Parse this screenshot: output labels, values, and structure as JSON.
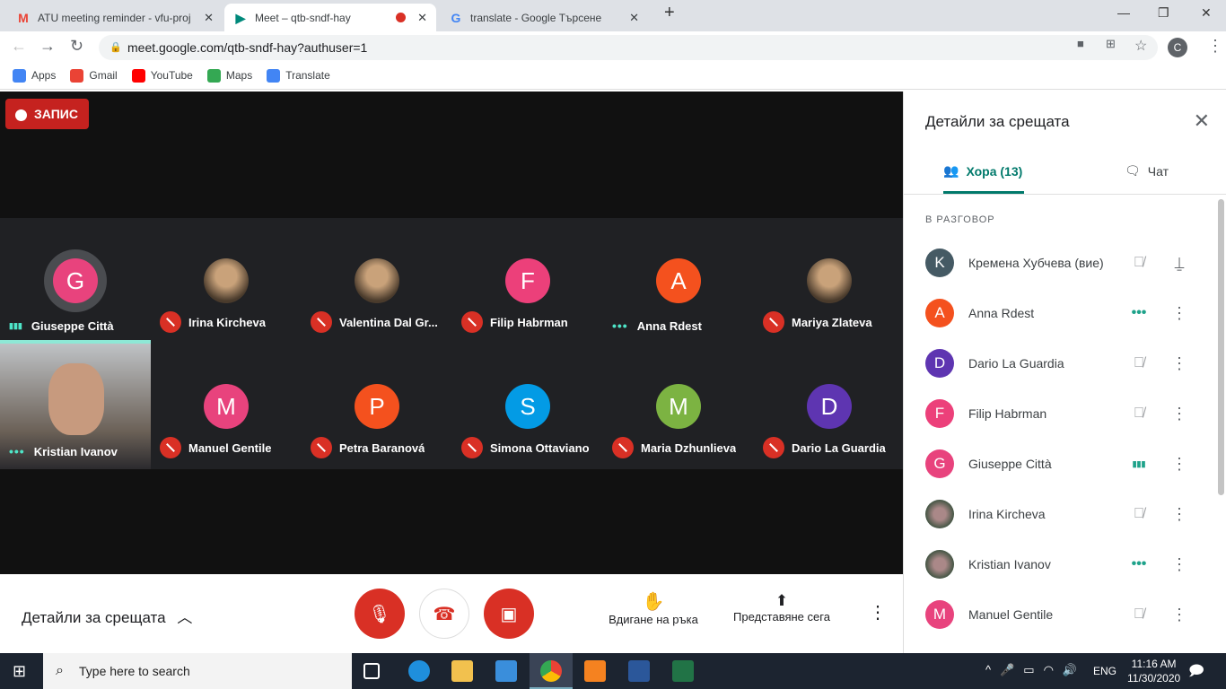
{
  "browser": {
    "tabs": [
      {
        "title": "ATU meeting reminder - vfu-proj",
        "icon": "gmail-icon"
      },
      {
        "title": "Meet – qtb-sndf-hay",
        "icon": "meet-icon",
        "active": true,
        "recording": true
      },
      {
        "title": "translate - Google Търсене",
        "icon": "google-icon"
      }
    ],
    "url": "meet.google.com/qtb-sndf-hay?authuser=1",
    "profile": "C",
    "bookmarks": [
      {
        "label": "Apps",
        "color": "#4285f4"
      },
      {
        "label": "Gmail",
        "color": "#ea4335"
      },
      {
        "label": "YouTube",
        "color": "#ff0000"
      },
      {
        "label": "Maps",
        "color": "#34a853"
      },
      {
        "label": "Translate",
        "color": "#4285f4"
      }
    ]
  },
  "meet": {
    "recording_label": "ЗАПИС",
    "tiles": [
      {
        "name": "Giuseppe Città",
        "initial": "G",
        "color": "#e8437d",
        "status": "speaking"
      },
      {
        "name": "Irina Kircheva",
        "photo": true,
        "status": "muted"
      },
      {
        "name": "Valentina Dal Gr...",
        "photo": true,
        "status": "muted"
      },
      {
        "name": "Filip Habrman",
        "initial": "F",
        "color": "#ec407a",
        "status": "muted"
      },
      {
        "name": "Anna Rdest",
        "initial": "A",
        "color": "#f4511e",
        "status": "dots"
      },
      {
        "name": "Mariya Zlateva",
        "photo": true,
        "status": "muted"
      },
      {
        "name": "Kristian Ivanov",
        "photo": true,
        "video": true,
        "status": "dots"
      },
      {
        "name": "Manuel Gentile",
        "initial": "M",
        "color": "#e8437d",
        "status": "muted"
      },
      {
        "name": "Petra Baranová",
        "initial": "P",
        "color": "#f4511e",
        "status": "muted"
      },
      {
        "name": "Simona Ottaviano",
        "initial": "S",
        "color": "#039be5",
        "status": "muted"
      },
      {
        "name": "Maria Dzhunlieva",
        "initial": "M",
        "color": "#7cb342",
        "status": "muted"
      },
      {
        "name": "Dario La Guardia",
        "initial": "D",
        "color": "#5e35b1",
        "status": "muted"
      }
    ],
    "bottom": {
      "details": "Детайли за срещата",
      "raise_hand": "Вдигане на ръка",
      "present": "Представяне сега"
    }
  },
  "panel": {
    "title": "Детайли за срещата",
    "tab_people": "Хора (13)",
    "tab_chat": "Чат",
    "section": "В РАЗГОВОР",
    "people": [
      {
        "name": "Кремена Хубчева (вие)",
        "initial": "K",
        "color": "#455a64",
        "status": "muted",
        "action": "pin"
      },
      {
        "name": "Anna Rdest",
        "initial": "A",
        "color": "#f4511e",
        "status": "dots"
      },
      {
        "name": "Dario La Guardia",
        "initial": "D",
        "color": "#5e35b1",
        "status": "muted"
      },
      {
        "name": "Filip Habrman",
        "initial": "F",
        "color": "#ec407a",
        "status": "muted"
      },
      {
        "name": "Giuseppe Città",
        "initial": "G",
        "color": "#e8437d",
        "status": "speaking"
      },
      {
        "name": "Irina Kircheva",
        "photo": true,
        "status": "muted"
      },
      {
        "name": "Kristian Ivanov",
        "photo": true,
        "status": "dots"
      },
      {
        "name": "Manuel Gentile",
        "initial": "M",
        "color": "#e8437d",
        "status": "muted"
      }
    ]
  },
  "taskbar": {
    "search_placeholder": "Type here to search",
    "lang": "ENG",
    "time": "11:16 AM",
    "date": "11/30/2020"
  }
}
